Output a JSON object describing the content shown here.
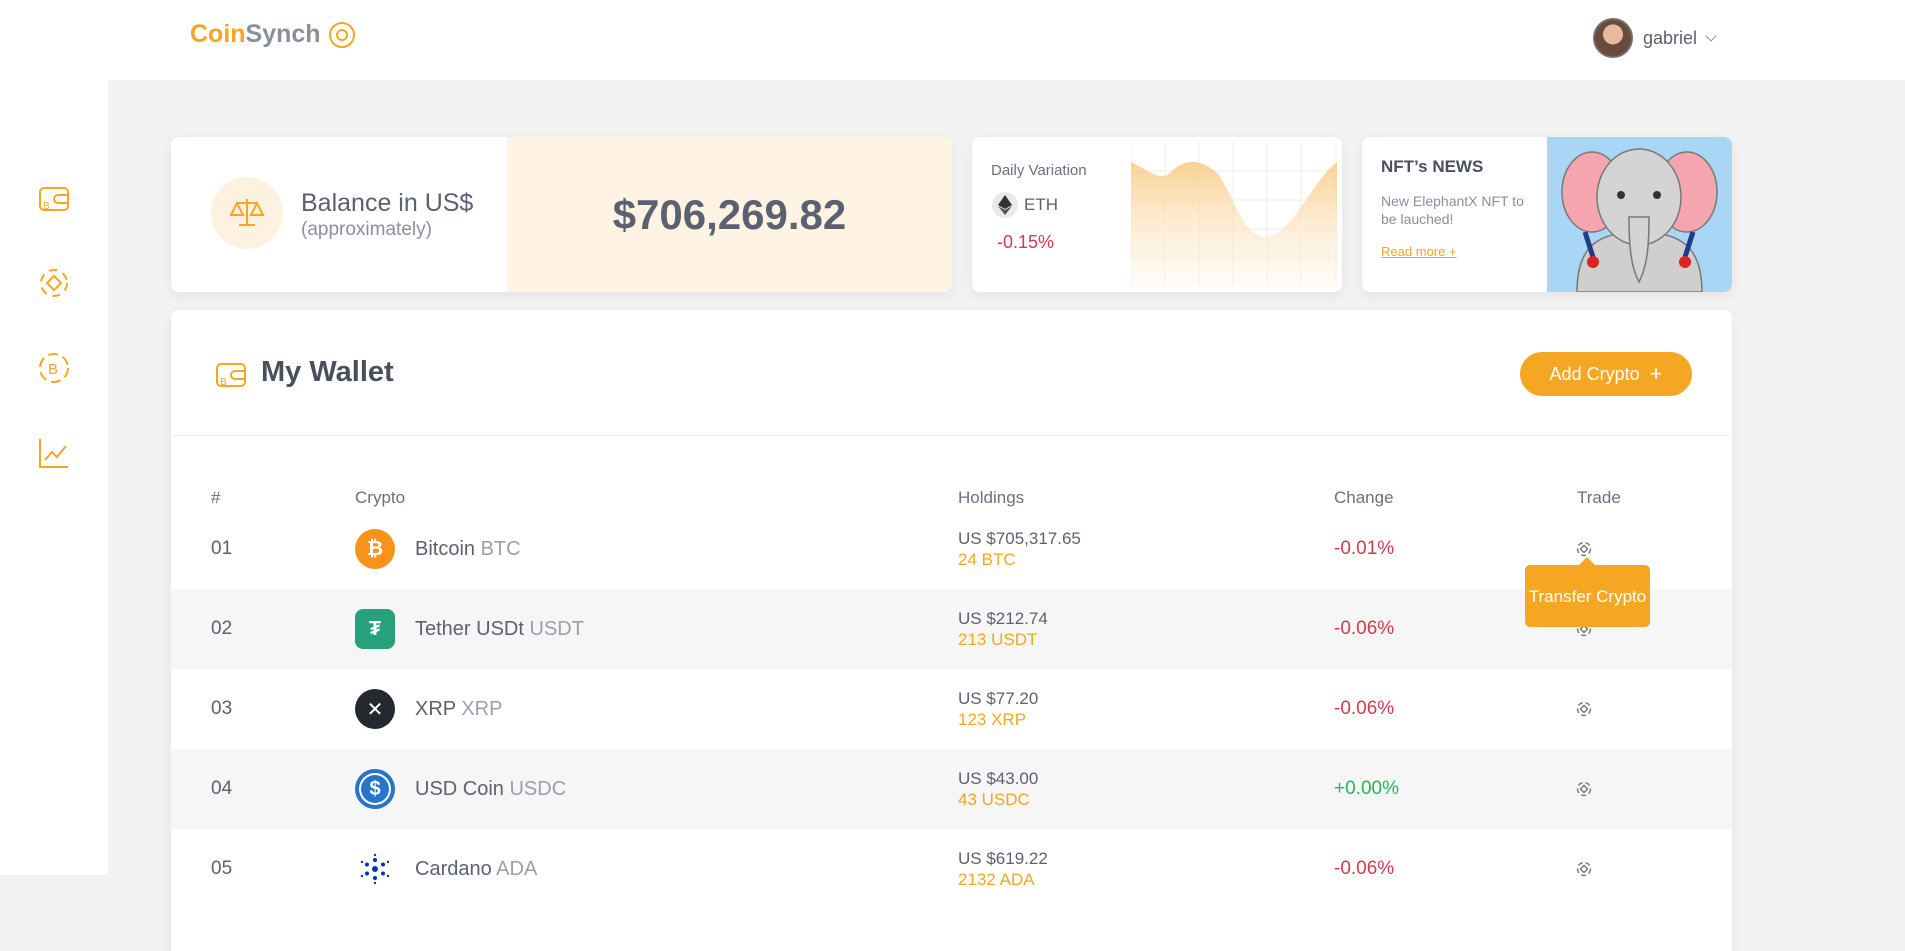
{
  "header": {
    "logo_part1": "Coin",
    "logo_part2": "Synch",
    "username": "gabriel"
  },
  "sidebar": {
    "items": [
      {
        "icon": "wallet-icon"
      },
      {
        "icon": "transfer-icon"
      },
      {
        "icon": "bitcoin-icon"
      },
      {
        "icon": "chart-icon"
      }
    ]
  },
  "balance": {
    "title": "Balance in US$",
    "subtitle": "(approximately)",
    "value": "$706,269.82"
  },
  "daily": {
    "label": "Daily Variation",
    "coin": "ETH",
    "change": "-0.15%"
  },
  "nft": {
    "title": "NFT’s NEWS",
    "text": "New ElephantX NFT to be lauched!",
    "link": "Read more +"
  },
  "wallet": {
    "title": "My Wallet",
    "add_label": "Add Crypto",
    "add_icon": "+",
    "columns": {
      "num": "#",
      "crypto": "Crypto",
      "holdings": "Holdings",
      "change": "Change",
      "trade": "Trade"
    },
    "rows": [
      {
        "num": "01",
        "name": "Bitcoin",
        "symbol": "BTC",
        "usd": "US $705,317.65",
        "amount": "24 BTC",
        "change": "-0.01%",
        "color": "#f7931a"
      },
      {
        "num": "02",
        "name": "Tether USDt",
        "symbol": "USDT",
        "usd": "US $212.74",
        "amount": "213 USDT",
        "change": "-0.06%",
        "color": "#26a17b"
      },
      {
        "num": "03",
        "name": "XRP",
        "symbol": "XRP",
        "usd": "US $77.20",
        "amount": "123 XRP",
        "change": "-0.06%",
        "color": "#23292f"
      },
      {
        "num": "04",
        "name": "USD Coin",
        "symbol": "USDC",
        "usd": "US $43.00",
        "amount": "43 USDC",
        "change": "+0.00%",
        "color": "#2775ca"
      },
      {
        "num": "05",
        "name": "Cardano",
        "symbol": "ADA",
        "usd": "US $619.22",
        "amount": "2132 ADA",
        "change": "-0.06%",
        "color": "#0033ad"
      }
    ],
    "tooltip": "Transfer Crypto"
  },
  "colors": {
    "accent": "#f5a623",
    "negative": "#d6394b",
    "positive": "#22b85a"
  }
}
